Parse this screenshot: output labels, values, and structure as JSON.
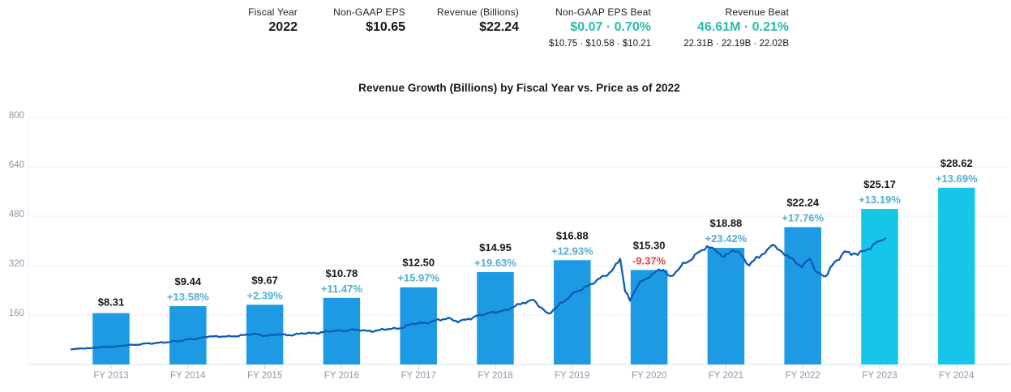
{
  "header": {
    "stats": [
      {
        "label": "Fiscal Year",
        "value": "2022",
        "sub": "",
        "accent": false
      },
      {
        "label": "Non-GAAP EPS",
        "value": "$10.65",
        "sub": "",
        "accent": false
      },
      {
        "label": "Revenue (Billions)",
        "value": "$22.24",
        "sub": "",
        "accent": false
      },
      {
        "label": "Non-GAAP EPS Beat",
        "value": "$0.07 · 0.70%",
        "sub": "$10.75 · $10.58 · $10.21",
        "accent": true
      },
      {
        "label": "Revenue Beat",
        "value": "46.61M · 0.21%",
        "sub": "22.31B · 22.19B · 22.02B",
        "accent": true
      }
    ]
  },
  "chart_data": {
    "type": "bar+line",
    "title": "Revenue Growth (Billions) by Fiscal Year vs. Price as of 2022",
    "categories": [
      "FY 2013",
      "FY 2014",
      "FY 2015",
      "FY 2016",
      "FY 2017",
      "FY 2018",
      "FY 2019",
      "FY 2020",
      "FY 2021",
      "FY 2022",
      "FY 2023",
      "FY 2024"
    ],
    "series": [
      {
        "name": "Revenue (Billions)",
        "type": "bar",
        "values": [
          8.31,
          9.44,
          9.67,
          10.78,
          12.5,
          14.95,
          16.88,
          15.3,
          18.88,
          22.24,
          25.17,
          28.62
        ],
        "value_labels": [
          "$8.31",
          "$9.44",
          "$9.67",
          "$10.78",
          "$12.50",
          "$14.95",
          "$16.88",
          "$15.30",
          "$18.88",
          "$22.24",
          "$25.17",
          "$28.62"
        ],
        "pct_change": [
          "",
          "+13.58%",
          "+2.39%",
          "+11.47%",
          "+15.97%",
          "+19.63%",
          "+12.93%",
          "-9.37%",
          "+23.42%",
          "+17.76%",
          "+13.19%",
          "+13.69%"
        ],
        "estimate": [
          false,
          false,
          false,
          false,
          false,
          false,
          false,
          false,
          false,
          false,
          true,
          true
        ]
      },
      {
        "name": "Price",
        "type": "line",
        "points_x_price": [
          [
            88,
            50
          ],
          [
            105,
            52
          ],
          [
            122,
            55
          ],
          [
            140,
            58
          ],
          [
            158,
            62
          ],
          [
            175,
            66
          ],
          [
            192,
            70
          ],
          [
            208,
            72
          ],
          [
            225,
            78
          ],
          [
            242,
            84
          ],
          [
            258,
            92
          ],
          [
            270,
            89
          ],
          [
            285,
            92
          ],
          [
            300,
            94
          ],
          [
            315,
            99
          ],
          [
            330,
            93
          ],
          [
            345,
            97
          ],
          [
            360,
            96
          ],
          [
            375,
            100
          ],
          [
            390,
            103
          ],
          [
            405,
            106
          ],
          [
            420,
            110
          ],
          [
            435,
            112
          ],
          [
            450,
            109
          ],
          [
            465,
            110
          ],
          [
            480,
            114
          ],
          [
            495,
            120
          ],
          [
            510,
            131
          ],
          [
            525,
            136
          ],
          [
            540,
            143
          ],
          [
            553,
            147
          ],
          [
            565,
            139
          ],
          [
            578,
            149
          ],
          [
            592,
            158
          ],
          [
            605,
            166
          ],
          [
            618,
            172
          ],
          [
            632,
            184
          ],
          [
            645,
            197
          ],
          [
            658,
            207
          ],
          [
            668,
            180
          ],
          [
            676,
            165
          ],
          [
            686,
            186
          ],
          [
            697,
            206
          ],
          [
            710,
            235
          ],
          [
            722,
            252
          ],
          [
            734,
            266
          ],
          [
            746,
            288
          ],
          [
            757,
            308
          ],
          [
            765,
            346
          ],
          [
            771,
            240
          ],
          [
            777,
            205
          ],
          [
            784,
            246
          ],
          [
            792,
            270
          ],
          [
            801,
            288
          ],
          [
            810,
            300
          ],
          [
            818,
            310
          ],
          [
            827,
            283
          ],
          [
            837,
            312
          ],
          [
            848,
            332
          ],
          [
            860,
            362
          ],
          [
            872,
            378
          ],
          [
            882,
            370
          ],
          [
            893,
            348
          ],
          [
            904,
            370
          ],
          [
            914,
            356
          ],
          [
            924,
            317
          ],
          [
            933,
            350
          ],
          [
            943,
            360
          ],
          [
            953,
            394
          ],
          [
            962,
            368
          ],
          [
            971,
            352
          ],
          [
            980,
            330
          ],
          [
            989,
            321
          ],
          [
            999,
            344
          ],
          [
            1008,
            298
          ],
          [
            1016,
            281
          ],
          [
            1024,
            312
          ],
          [
            1032,
            334
          ],
          [
            1042,
            370
          ],
          [
            1050,
            355
          ],
          [
            1058,
            362
          ],
          [
            1067,
            370
          ],
          [
            1077,
            386
          ],
          [
            1085,
            397
          ],
          [
            1092,
            408
          ]
        ]
      }
    ],
    "y_axis": {
      "ticks": [
        160,
        320,
        480,
        640,
        800
      ],
      "range": [
        0,
        800
      ],
      "grid": true
    },
    "hidden_revenue_axis_max": 40,
    "legend": "none"
  },
  "colors": {
    "bar_actual": "#1e9ae4",
    "bar_estimate": "#16c6e9",
    "price_line": "#0a5cb5",
    "pct_positive": "#52add3",
    "pct_negative": "#e5413e",
    "accent_teal": "#2bbca9",
    "grid_line": "#eceff5",
    "axis_line": "#e2e6ee",
    "tick_mark": "#ccd3de",
    "axis_text": "#8d97a9"
  }
}
